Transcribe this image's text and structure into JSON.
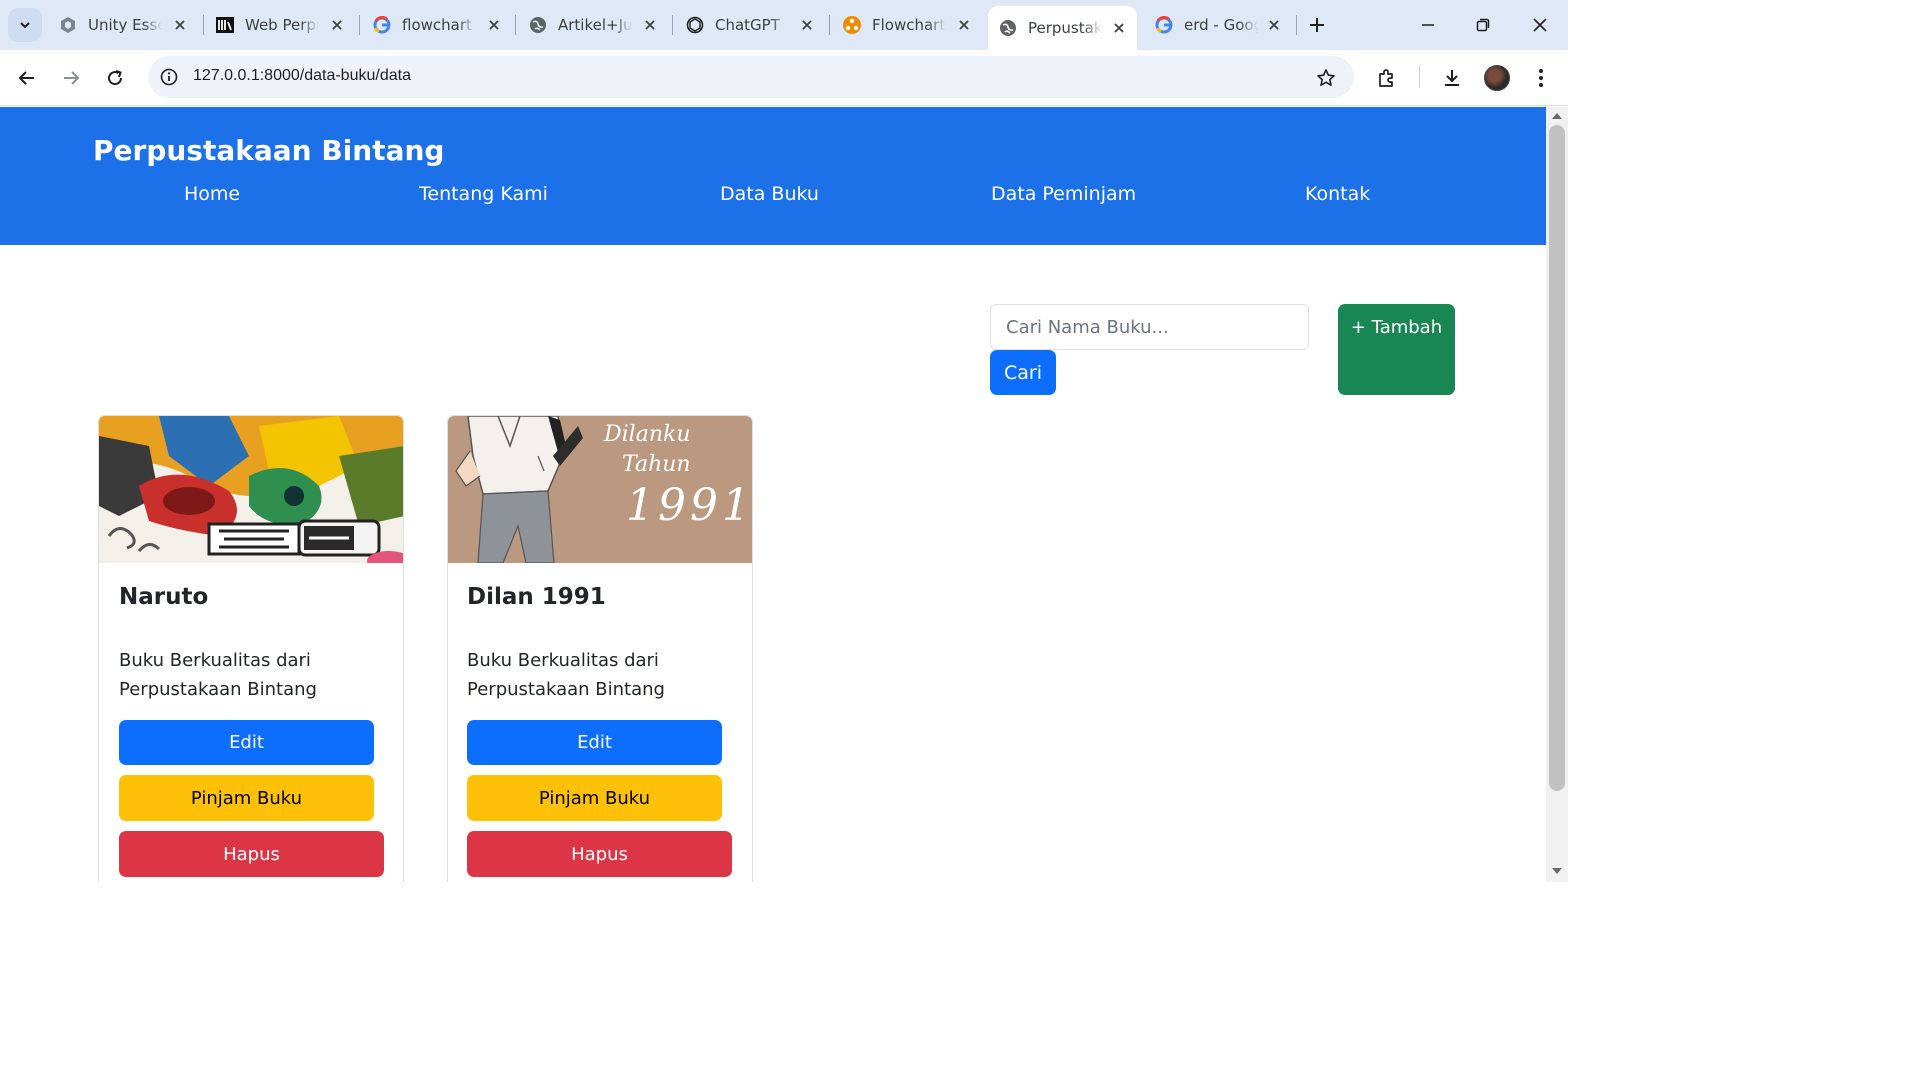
{
  "browser": {
    "tabs": [
      {
        "title": "Unity Esser",
        "icon": "unity-icon"
      },
      {
        "title": "Web Perpu",
        "icon": "book-icon"
      },
      {
        "title": "flowchart w",
        "icon": "google-icon"
      },
      {
        "title": "Artikel+Jur",
        "icon": "globe-icon"
      },
      {
        "title": "ChatGPT",
        "icon": "chatgpt-icon"
      },
      {
        "title": "FlowchartW",
        "icon": "flowchart-icon"
      },
      {
        "title": "Perpustaka",
        "icon": "globe-icon",
        "active": true
      },
      {
        "title": "erd - Goog",
        "icon": "google-icon"
      }
    ],
    "url": "127.0.0.1:8000/data-buku/data"
  },
  "navbar": {
    "brand": "Perpustakaan Bintang",
    "links": [
      "Home",
      "Tentang Kami",
      "Data Buku",
      "Data Peminjam",
      "Kontak"
    ]
  },
  "search": {
    "placeholder": "Cari Nama Buku...",
    "button": "Cari"
  },
  "add_button": "+ Tambah",
  "books": [
    {
      "title": "Naruto",
      "description": "Buku Berkualitas dari Perpustakaan Bintang",
      "edit": "Edit",
      "borrow": "Pinjam Buku",
      "delete": "Hapus"
    },
    {
      "title": "Dilan 1991",
      "description": "Buku Berkualitas dari Perpustakaan Bintang",
      "cover_text": [
        "Dilanku",
        "Tahun",
        "1991"
      ],
      "edit": "Edit",
      "borrow": "Pinjam Buku",
      "delete": "Hapus"
    }
  ],
  "colors": {
    "navbar": "#1c70e8",
    "primary": "#0d6efd",
    "success": "#198754",
    "warning": "#ffc107",
    "danger": "#dc3545"
  }
}
